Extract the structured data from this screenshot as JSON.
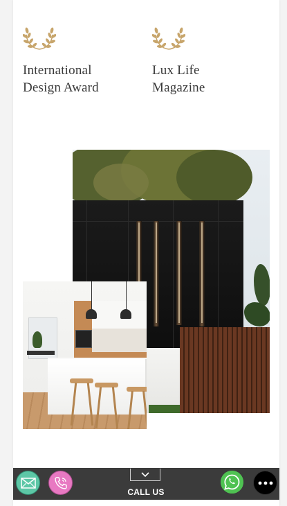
{
  "awards": [
    {
      "line1": "International",
      "line2": "Design Award",
      "icon": "laurel-wreath-icon"
    },
    {
      "line1": "Lux Life",
      "line2": "Magazine",
      "icon": "laurel-wreath-icon"
    }
  ],
  "images": {
    "exterior": "modern-black-facade-photo",
    "kitchen": "white-kitchen-photo"
  },
  "contact_bar": {
    "call_label": "CALL US",
    "buttons": [
      "email-icon",
      "phone-icon",
      "whatsapp-icon",
      "more-icon"
    ]
  },
  "colors": {
    "laurel_gold": "#c7a56b",
    "bar_bg": "#3b3b3b",
    "email": "#5dc7a6",
    "phone": "#e879c2",
    "whatsapp": "#4fc252"
  }
}
